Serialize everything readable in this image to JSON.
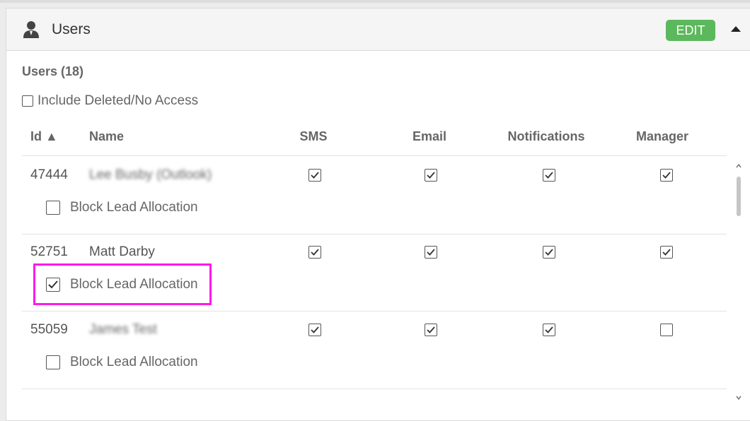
{
  "panel": {
    "title": "Users",
    "edit_label": "EDIT",
    "edit_color": "#5cb85c",
    "icon": "user-icon",
    "collapse_icon": "caret-up-icon"
  },
  "users_section": {
    "count_label": "Users (18)",
    "include_deleted_label": "Include Deleted/No Access",
    "include_deleted_checked": false
  },
  "table": {
    "headers": {
      "id": "Id ▲",
      "name": "Name",
      "sms": "SMS",
      "email": "Email",
      "notifications": "Notifications",
      "manager": "Manager"
    },
    "rows": [
      {
        "id": "47444",
        "name": "Lee Busby (Outlook)",
        "name_blurred": true,
        "sms": true,
        "email": true,
        "notifications": true,
        "manager": true,
        "block_label": "Block Lead Allocation",
        "block_checked": false
      },
      {
        "id": "52751",
        "name": "Matt Darby",
        "name_blurred": false,
        "sms": true,
        "email": true,
        "notifications": true,
        "manager": true,
        "block_label": "Block Lead Allocation",
        "block_checked": true,
        "highlighted": true
      },
      {
        "id": "55059",
        "name": "James Test",
        "name_blurred": true,
        "sms": true,
        "email": true,
        "notifications": true,
        "manager": false,
        "block_label": "Block Lead Allocation",
        "block_checked": false
      }
    ]
  },
  "colors": {
    "highlight": "#ff19e8"
  }
}
